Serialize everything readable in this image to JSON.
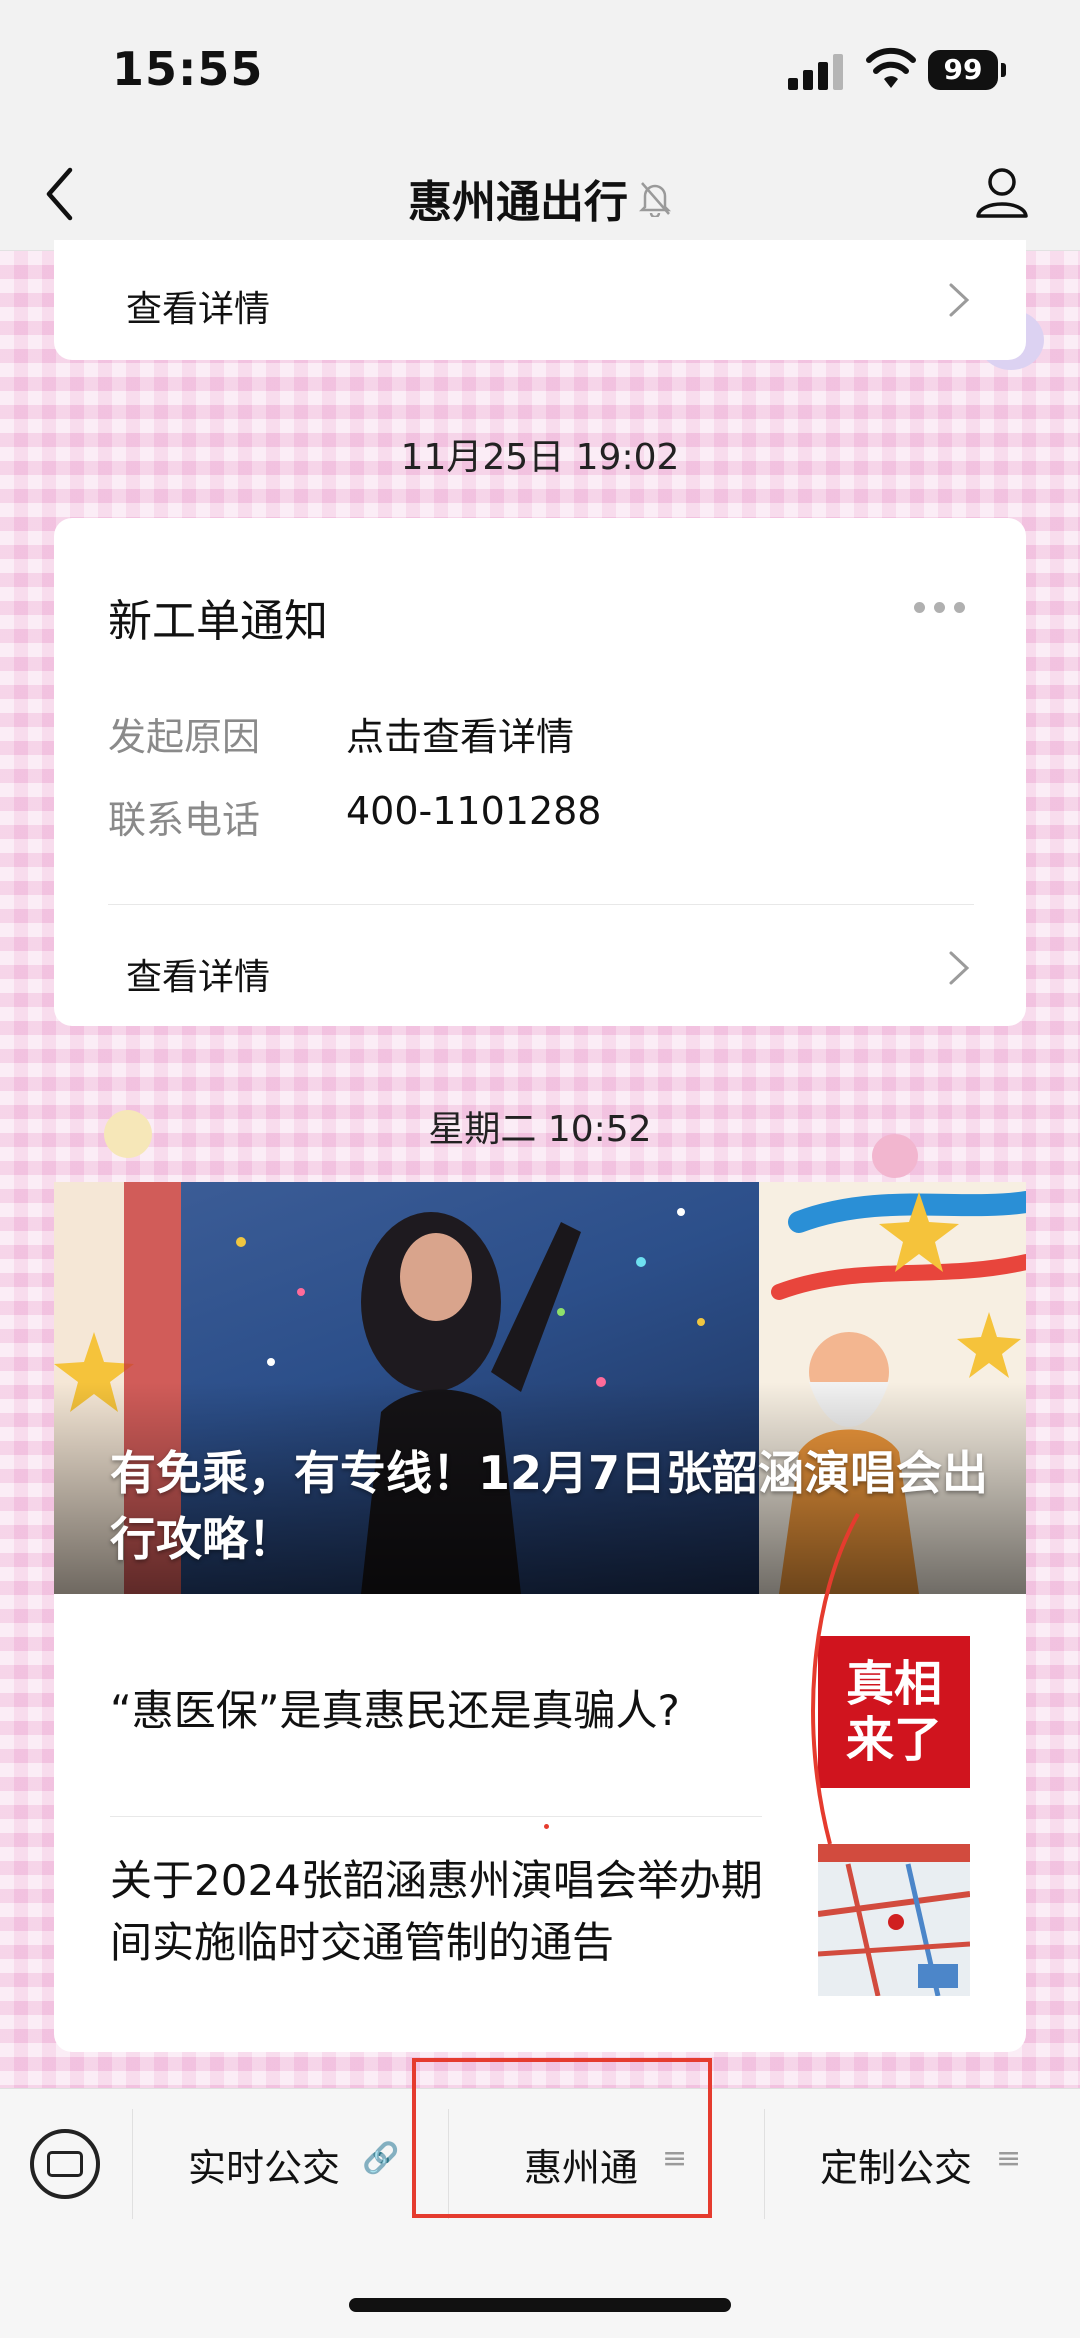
{
  "status_bar": {
    "time": "15:55",
    "battery": "99"
  },
  "nav": {
    "title": "惠州通出行"
  },
  "messages": {
    "top_detail_label": "查看详情",
    "timestamp1": "11月25日 19:02",
    "notification": {
      "title": "新工单通知",
      "fields": [
        {
          "label": "发起原因",
          "value": "点击查看详情"
        },
        {
          "label": "联系电话",
          "value": "400-1101288"
        }
      ],
      "detail_label": "查看详情"
    },
    "timestamp2": "星期二 10:52",
    "news": {
      "banner_title": "有免乘，有专线！12月7日张韶涵演唱会出行攻略！",
      "articles": [
        {
          "title": "“惠医保”是真惠民还是真骗人?",
          "thumb_text": [
            "真相",
            "来了"
          ]
        },
        {
          "title": "关于2024张韶涵惠州演唱会举办期间实施临时交通管制的通告"
        }
      ]
    }
  },
  "bottom_menu": {
    "items": [
      {
        "label": "实时公交",
        "icon": "link-icon"
      },
      {
        "label": "惠州通",
        "icon": "menu-lines-icon"
      },
      {
        "label": "定制公交",
        "icon": "menu-lines-icon"
      }
    ]
  },
  "colors": {
    "highlight_box": "#e53b2e",
    "thumb_red": "#d0141e"
  }
}
